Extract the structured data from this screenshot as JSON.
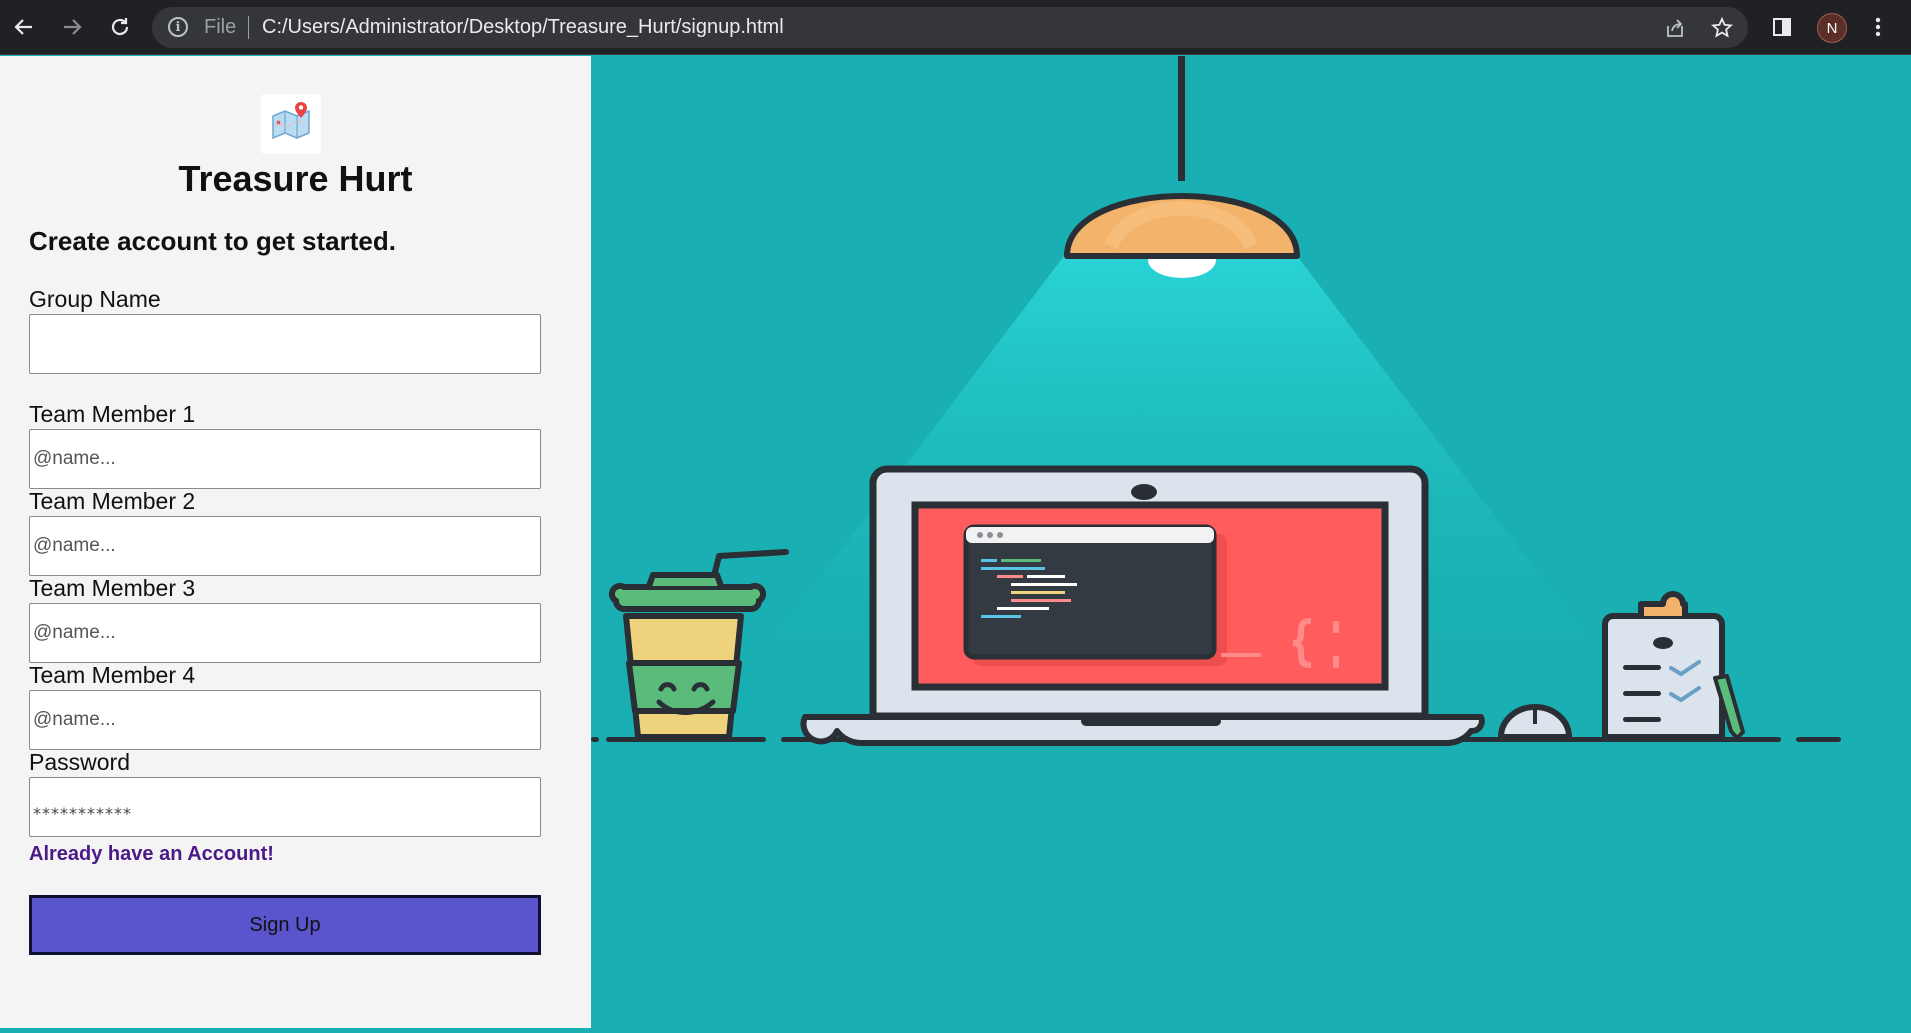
{
  "browser": {
    "back_icon": "arrow-left-icon",
    "forward_icon": "arrow-right-icon",
    "reload_icon": "reload-icon",
    "info_icon": "info-icon",
    "scheme_label": "File",
    "url": "C:/Users/Administrator/Desktop/Treasure_Hurt/signup.html",
    "share_icon": "share-icon",
    "bookmark_icon": "star-icon",
    "sidepanel_icon": "side-panel-icon",
    "avatar_letter": "N",
    "menu_icon": "kebab-menu-icon"
  },
  "form": {
    "title": "Treasure Hurt",
    "subtitle": "Create account to get started.",
    "group_name_label": "Group Name",
    "group_name_value": "",
    "members": [
      {
        "label": "Team Member 1",
        "placeholder": "@name..."
      },
      {
        "label": "Team Member 2",
        "placeholder": "@name..."
      },
      {
        "label": "Team Member 3",
        "placeholder": "@name..."
      },
      {
        "label": "Team Member 4",
        "placeholder": "@name..."
      }
    ],
    "password_label": "Password",
    "password_value": "***********",
    "login_link": "Already have an Account!",
    "submit_label": "Sign Up"
  },
  "colors": {
    "background": "#1ab0b3",
    "panel": "#f4f4f4",
    "button": "#5a55cc",
    "link": "#4b1a88"
  }
}
